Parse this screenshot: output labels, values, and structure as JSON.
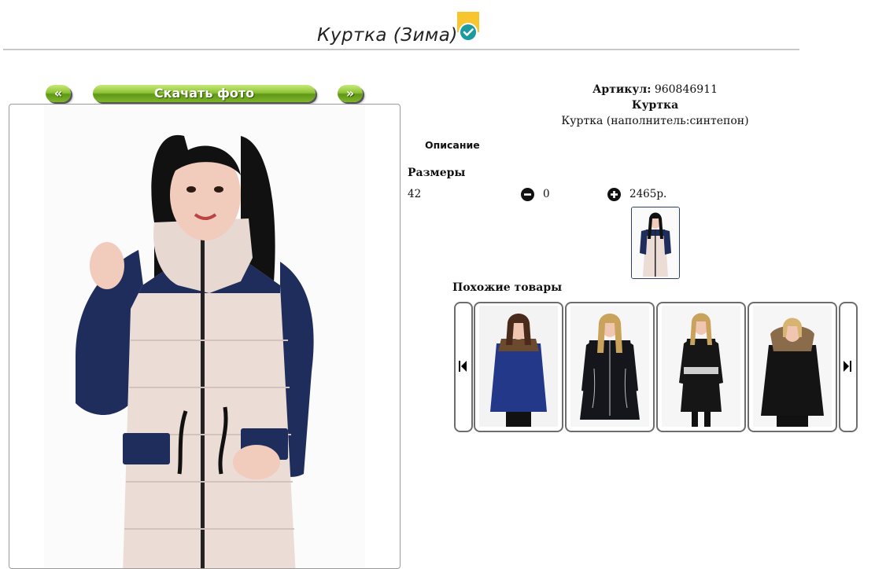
{
  "header": {
    "title": "Куртка (Зима)",
    "badge_icon": "check-badge-icon"
  },
  "gallery": {
    "prev_label": "«",
    "download_label": "Скачать фото",
    "next_label": "»"
  },
  "product": {
    "article_label": "Артикул:",
    "article_value": "960846911",
    "name": "Куртка",
    "subtitle": "Куртка (наполнитель:синтепон)"
  },
  "description_label": "Описание",
  "sizes": {
    "label": "Размеры",
    "rows": [
      {
        "size": "42",
        "quantity": "0",
        "price": "2465р."
      }
    ]
  },
  "similar": {
    "label": "Похожие товары",
    "items": [
      {
        "color": "navy",
        "hood": "fur"
      },
      {
        "color": "black",
        "hood": "plain"
      },
      {
        "color": "black",
        "hood": "plain"
      },
      {
        "color": "black",
        "hood": "fur"
      }
    ]
  },
  "colors": {
    "accent_green": "#7eb52a",
    "navy": "#1f2d5c",
    "jacket_beige": "#ecdcd6"
  }
}
